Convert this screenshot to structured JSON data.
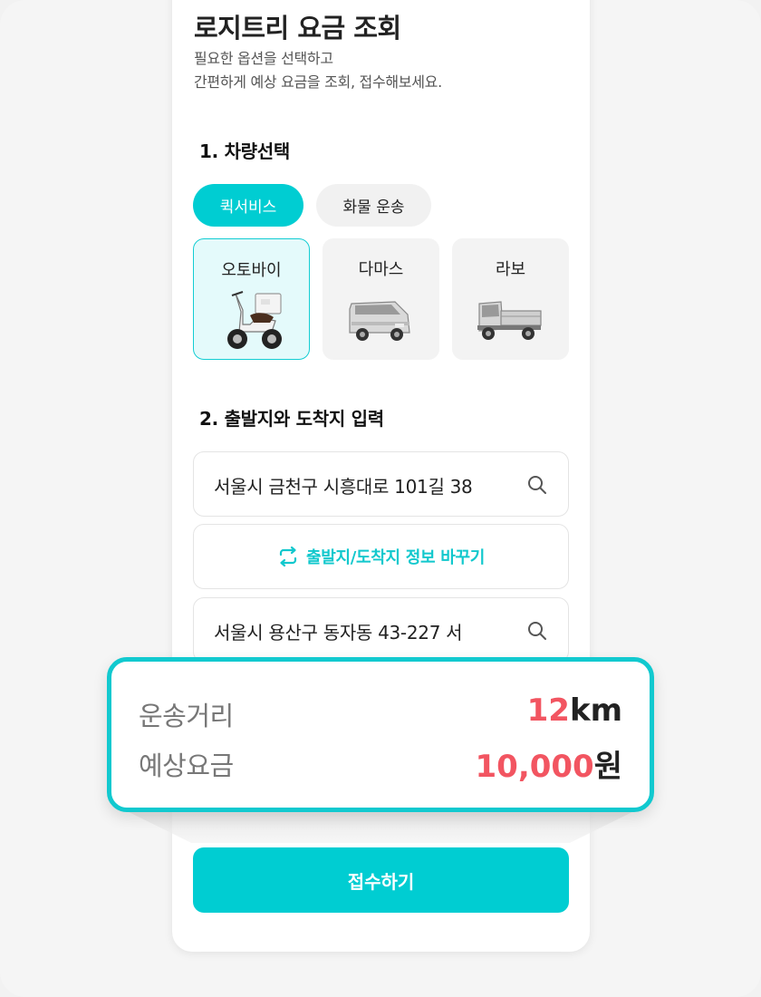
{
  "header": {
    "title": "로지트리 요금 조회",
    "subtitle_line1": "필요한 옵션을 선택하고",
    "subtitle_line2": "간편하게 예상 요금을 조회, 접수해보세요."
  },
  "vehicle_section": {
    "title": "1. 차량선택",
    "service_tabs": [
      {
        "label": "퀵서비스",
        "selected": true
      },
      {
        "label": "화물 운송",
        "selected": false
      }
    ],
    "vehicles": [
      {
        "label": "오토바이",
        "icon": "scooter-icon",
        "selected": true
      },
      {
        "label": "다마스",
        "icon": "van-icon",
        "selected": false
      },
      {
        "label": "라보",
        "icon": "truck-icon",
        "selected": false
      }
    ]
  },
  "route_section": {
    "title": "2. 출발지와 도착지 입력",
    "origin": "서울시 금천구 시흥대로 101길 38",
    "swap_label": "출발지/도착지 정보 바꾸기",
    "destination": "서울시 용산구 동자동 43-227 서"
  },
  "result": {
    "distance_label": "운송거리",
    "distance_value": "12",
    "distance_unit": "km",
    "fare_label": "예상요금",
    "fare_value": "10,000",
    "fare_unit": "원"
  },
  "submit_label": "접수하기",
  "colors": {
    "accent": "#00cdd2",
    "highlight_number": "#f25561"
  }
}
